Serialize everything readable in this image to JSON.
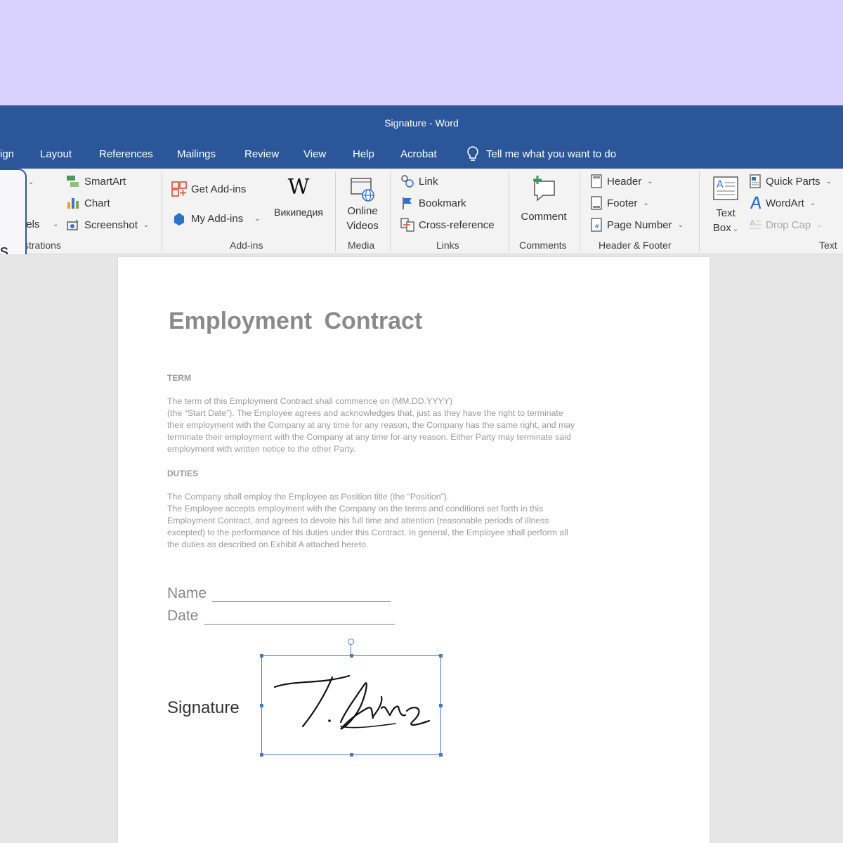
{
  "window": {
    "title": "Signature - Word"
  },
  "tabs": [
    "ign",
    "Layout",
    "References",
    "Mailings",
    "Review",
    "View",
    "Help",
    "Acrobat"
  ],
  "tell_me": "Tell me what you want to do",
  "callout": {
    "text": "s"
  },
  "ribbon": {
    "illustrations": {
      "smartart": "SmartArt",
      "chart": "Chart",
      "screenshot": "Screenshot",
      "models_cut": "lels",
      "label": "strations"
    },
    "addins": {
      "get": "Get Add-ins",
      "my": "My Add-ins",
      "wiki": "Википедия",
      "label": "Add-ins"
    },
    "media": {
      "line1": "Online",
      "line2": "Videos",
      "label": "Media"
    },
    "links": {
      "link": "Link",
      "bookmark": "Bookmark",
      "crossref": "Cross-reference",
      "label": "Links"
    },
    "comments": {
      "comment": "Comment",
      "label": "Comments"
    },
    "header_footer": {
      "header": "Header",
      "footer": "Footer",
      "page_number": "Page Number",
      "label": "Header & Footer"
    },
    "text": {
      "textbox1": "Text",
      "textbox2": "Box",
      "quick_parts": "Quick Parts",
      "wordart": "WordArt",
      "drop_cap": "Drop Cap",
      "label": "Text"
    }
  },
  "document": {
    "title": "Employment  Contract",
    "term_heading": "TERM",
    "term_lines": [
      "The term of this Employment Contract shall commence on (MM.DD.YYYY)",
      "(the “Start Date”). The Employee agrees and acknowledges that, just as they have the right to terminate",
      "their employment with the Company at any time for any reason, the Company has the same right, and may",
      "terminate their employment with the Company at any time for any reason. Either Party may terminate said",
      "employment with written notice to the other Party."
    ],
    "duties_heading": "DUTIES",
    "duties_lines": [
      "The Company shall employ the Employee as Position title (the “Position”).",
      "The Employee accepts employment with the Company on the terms and conditions set forth in this",
      "Employment Contract, and agrees to devote his full time and attention (reasonable periods of illness",
      "excepted) to the performance of his duties under this Contract. In general, the Employee shall perform all",
      "the duties as described on Exhibit A attached hereto."
    ],
    "name_label": "Name",
    "date_label": "Date",
    "signature_label": "Signature"
  },
  "colors": {
    "accent": "#2b579a",
    "background": "#d8d0fd",
    "selection": "#4a78c8"
  }
}
